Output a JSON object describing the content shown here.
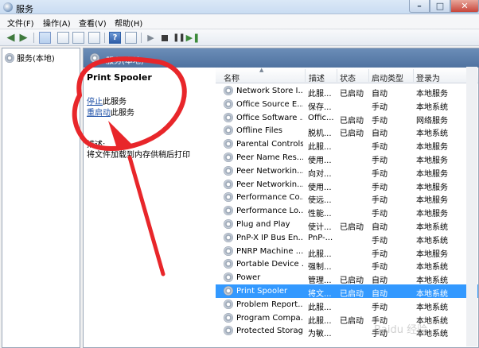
{
  "window": {
    "title": "服务"
  },
  "menu": [
    "文件(F)",
    "操作(A)",
    "查看(V)",
    "帮助(H)"
  ],
  "tree": {
    "item": "服务(本地)"
  },
  "pane": {
    "title": "服务(本地)"
  },
  "detail": {
    "service_name": "Print Spooler",
    "stop_link": "停止",
    "stop_suffix": "此服务",
    "restart_link": "重启动",
    "restart_suffix": "此服务",
    "desc_label": "描述:",
    "desc_text": "将文件加载到内存供稍后打印"
  },
  "columns": [
    "名称",
    "描述",
    "状态",
    "启动类型",
    "登录为"
  ],
  "rows": [
    {
      "name": "Network Store I...",
      "desc": "此服...",
      "status": "已启动",
      "start": "自动",
      "logon": "本地服务"
    },
    {
      "name": "Office Source E...",
      "desc": "保存...",
      "status": "",
      "start": "手动",
      "logon": "本地系统"
    },
    {
      "name": "Office Software ...",
      "desc": "Offic...",
      "status": "已启动",
      "start": "手动",
      "logon": "网络服务"
    },
    {
      "name": "Offline Files",
      "desc": "脱机...",
      "status": "已启动",
      "start": "自动",
      "logon": "本地系统"
    },
    {
      "name": "Parental Controls",
      "desc": "此服...",
      "status": "",
      "start": "手动",
      "logon": "本地服务"
    },
    {
      "name": "Peer Name Res...",
      "desc": "使用...",
      "status": "",
      "start": "手动",
      "logon": "本地服务"
    },
    {
      "name": "Peer Networkin...",
      "desc": "向对...",
      "status": "",
      "start": "手动",
      "logon": "本地服务"
    },
    {
      "name": "Peer Networkin...",
      "desc": "使用...",
      "status": "",
      "start": "手动",
      "logon": "本地服务"
    },
    {
      "name": "Performance Co...",
      "desc": "使远...",
      "status": "",
      "start": "手动",
      "logon": "本地服务"
    },
    {
      "name": "Performance Lo...",
      "desc": "性能...",
      "status": "",
      "start": "手动",
      "logon": "本地服务"
    },
    {
      "name": "Plug and Play",
      "desc": "使计...",
      "status": "已启动",
      "start": "自动",
      "logon": "本地系统"
    },
    {
      "name": "PnP-X IP Bus En...",
      "desc": "PnP-...",
      "status": "",
      "start": "手动",
      "logon": "本地系统"
    },
    {
      "name": "PNRP Machine ...",
      "desc": "此服...",
      "status": "",
      "start": "手动",
      "logon": "本地服务"
    },
    {
      "name": "Portable Device ...",
      "desc": "强制...",
      "status": "",
      "start": "手动",
      "logon": "本地系统"
    },
    {
      "name": "Power",
      "desc": "管理...",
      "status": "已启动",
      "start": "自动",
      "logon": "本地系统"
    },
    {
      "name": "Print Spooler",
      "desc": "将文...",
      "status": "已启动",
      "start": "自动",
      "logon": "本地系统",
      "selected": true
    },
    {
      "name": "Problem Report...",
      "desc": "此服...",
      "status": "",
      "start": "手动",
      "logon": "本地系统"
    },
    {
      "name": "Program Compa...",
      "desc": "此服...",
      "status": "已启动",
      "start": "手动",
      "logon": "本地系统"
    },
    {
      "name": "Protected Storage",
      "desc": "为敏...",
      "status": "",
      "start": "手动",
      "logon": "本地系统"
    }
  ],
  "colors": {
    "selection": "#3399ff",
    "annotation": "#e8262a",
    "link": "#1b4ea6"
  }
}
